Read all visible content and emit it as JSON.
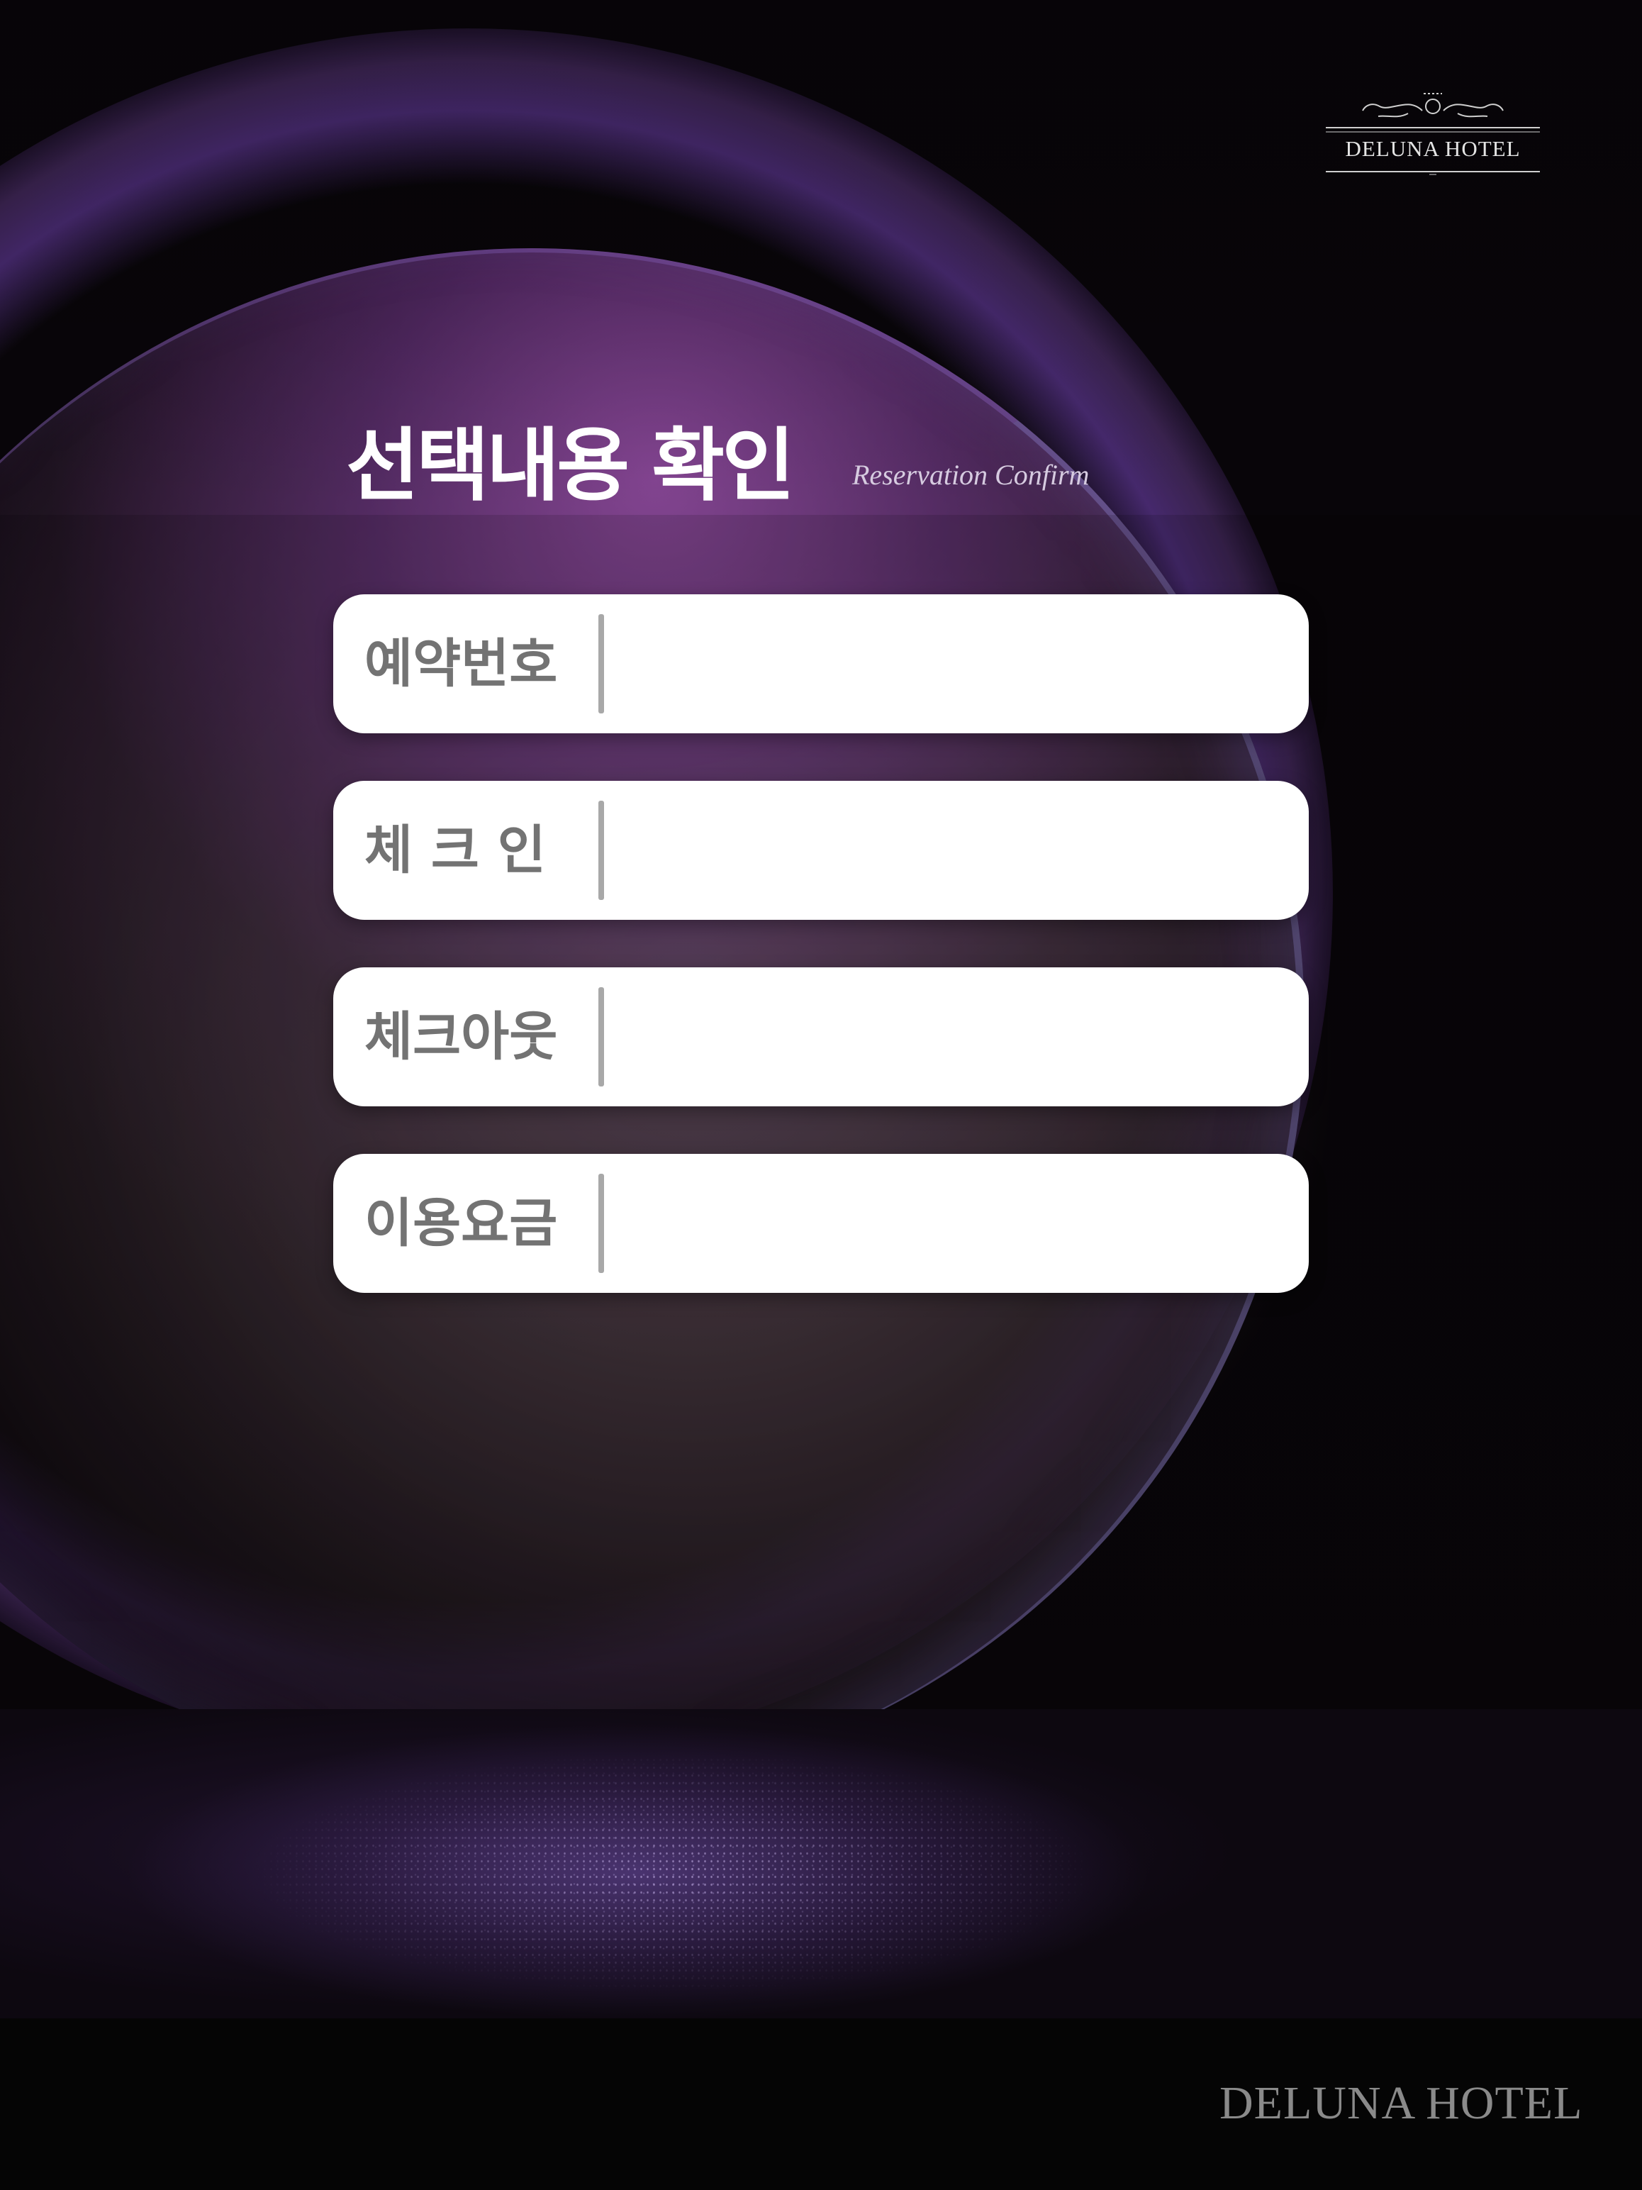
{
  "brand": {
    "logo_text": "DELUNA HOTEL",
    "footer_text": "DELUNA HOTEL"
  },
  "header": {
    "title": "선택내용 확인",
    "subtitle": "Reservation Confirm"
  },
  "fields": [
    {
      "label": "예약번호",
      "value": ""
    },
    {
      "label": "체 크 인",
      "value": ""
    },
    {
      "label": "체크아웃",
      "value": ""
    },
    {
      "label": "이용요금",
      "value": ""
    }
  ],
  "colors": {
    "accent": "#7a4bb0",
    "field_background": "#ffffff",
    "label_text": "#737373",
    "footer_text": "#8a8a8a"
  }
}
